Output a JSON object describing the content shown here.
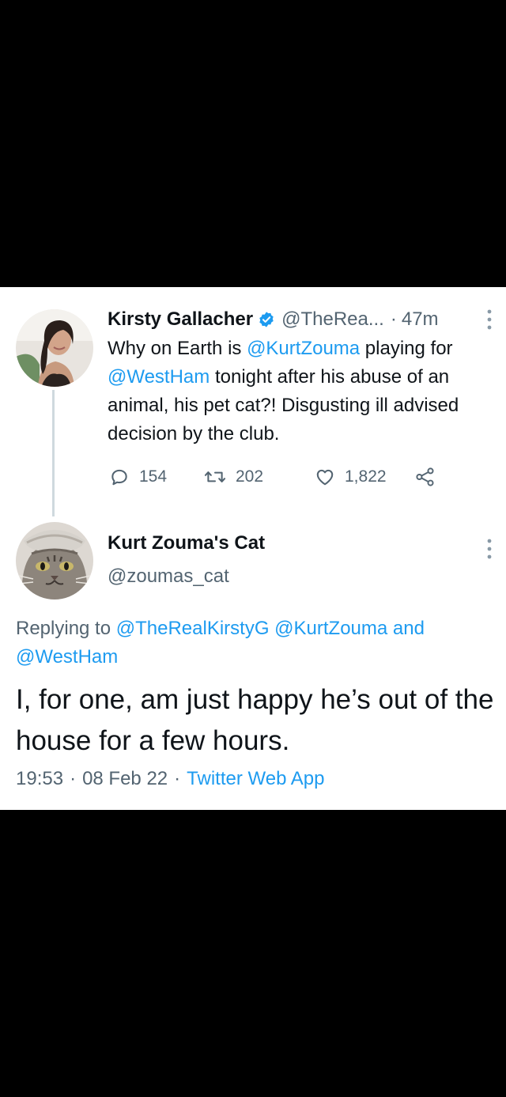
{
  "tweet1": {
    "name": "Kirsty Gallacher",
    "handle": "@TheRea...",
    "separator": "·",
    "time": "47m",
    "text_part1": "Why on Earth is ",
    "mention1": "@KurtZouma",
    "text_part2": " playing for ",
    "mention2": "@WestHam",
    "text_part3": " tonight after his abuse of an animal, his pet cat?! Disgusting ill advised decision by the club.",
    "replies": "154",
    "retweets": "202",
    "likes": "1,822"
  },
  "tweet2": {
    "name": "Kurt Zouma's Cat",
    "handle": "@zoumas_cat",
    "replying_prefix": "Replying to ",
    "replying_mention1": "@TheRealKirstyG",
    "replying_mention2": "@KurtZouma",
    "replying_and": " and ",
    "replying_mention3": "@WestHam",
    "text": "I, for one, am just happy he’s out of the house for a few hours.",
    "time": "19:53",
    "date": "08 Feb 22",
    "separator": "·",
    "app": "Twitter Web App"
  },
  "colors": {
    "link": "#1d9bf0",
    "secondary_text": "#536471",
    "primary_text": "#0f1419",
    "background": "#ffffff",
    "outer_background": "#000000"
  },
  "icons": [
    "verified-badge-icon",
    "more-icon",
    "reply-icon",
    "retweet-icon",
    "like-icon",
    "share-icon"
  ]
}
